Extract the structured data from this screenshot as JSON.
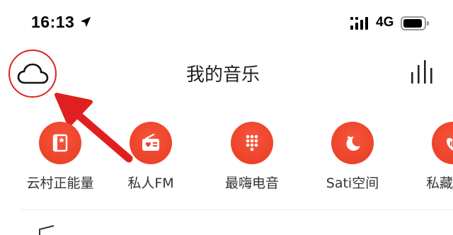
{
  "status_bar": {
    "time": "16:13",
    "network": "4G",
    "icons": [
      "location-arrow-icon",
      "signal-icon",
      "battery-icon"
    ]
  },
  "header": {
    "title": "我的音乐",
    "left_icon": "cloud-icon",
    "right_icon": "equalizer-icon"
  },
  "shortcuts": [
    {
      "label": "云村正能量",
      "icon": "card-star-icon"
    },
    {
      "label": "私人FM",
      "icon": "radio-heart-icon"
    },
    {
      "label": "最嗨电音",
      "icon": "keypad-dots-icon"
    },
    {
      "label": "Sati空间",
      "icon": "moon-star-icon"
    },
    {
      "label": "私藏",
      "icon": "heart-wave-icon"
    }
  ],
  "colors": {
    "accent": "#ec4329",
    "annotation": "#e02020",
    "text": "#222222"
  }
}
